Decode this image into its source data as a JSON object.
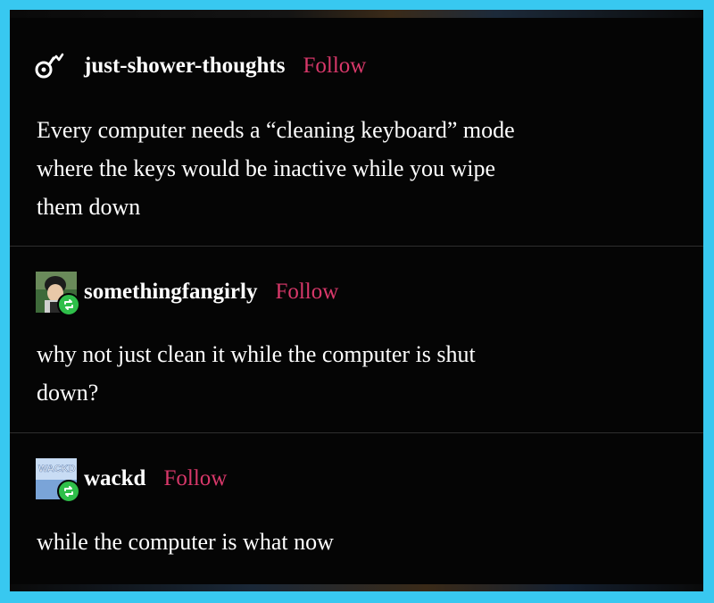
{
  "posts": [
    {
      "username": "just-shower-thoughts",
      "follow_label": "Follow",
      "avatar_icon": "shower-head-icon",
      "reblogged": false,
      "text_lines": [
        "Every computer needs a “cleaning keyboard” mode",
        "where the keys would be inactive while you wipe",
        "them down"
      ]
    },
    {
      "username": "somethingfangirly",
      "follow_label": "Follow",
      "avatar_icon": "anime-character-avatar",
      "reblogged": true,
      "text_lines": [
        "why not just clean it while the computer is shut",
        "down?"
      ]
    },
    {
      "username": "wackd",
      "follow_label": "Follow",
      "avatar_icon": "wackd-logo-avatar",
      "avatar_text": "WACKD",
      "reblogged": true,
      "text_lines": [
        "while the computer is what now"
      ]
    }
  ],
  "colors": {
    "background": "#050505",
    "frame_border": "#38c8f0",
    "follow": "#d8386a",
    "reblog_badge": "#2fbf4a",
    "text": "#ffffff"
  }
}
